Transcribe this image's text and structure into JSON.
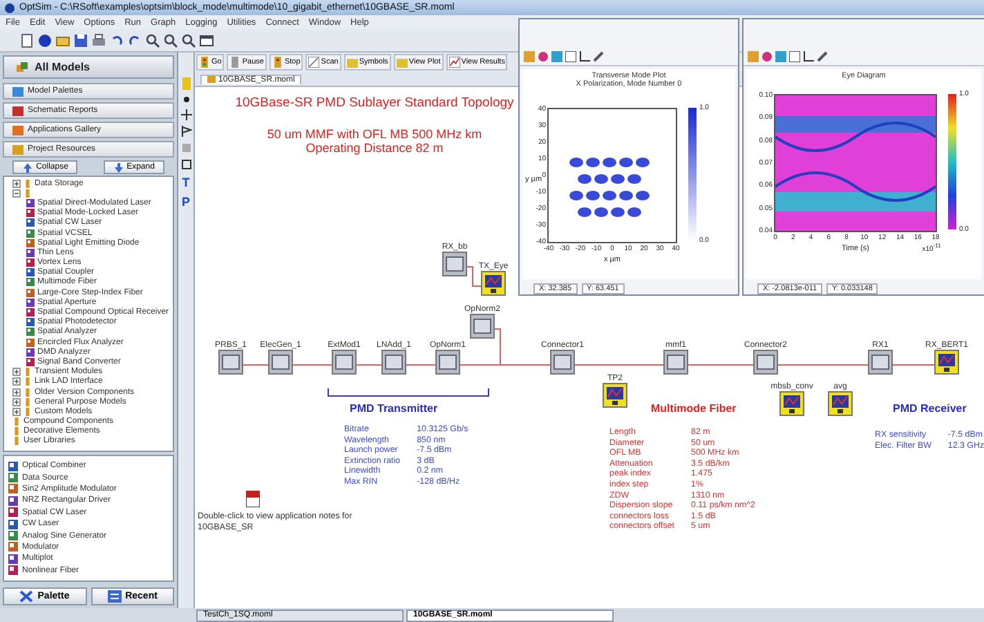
{
  "window": {
    "title": "OptSim - C:\\RSoft\\examples\\optsim\\block_mode\\multimode\\10_gigabit_ethernet\\10GBASE_SR.moml"
  },
  "menu": [
    "File",
    "Edit",
    "View",
    "Options",
    "Run",
    "Graph",
    "Logging",
    "Utilities",
    "Connect",
    "Window",
    "Help"
  ],
  "models_panel": {
    "title": "All Models",
    "sections": [
      "Model Palettes",
      "Schematic Reports",
      "Applications Gallery",
      "Project Resources"
    ],
    "buttons": [
      "Collapse",
      "Expand"
    ],
    "tree": [
      {
        "label": "Data Storage",
        "expanded": false
      },
      {
        "expanded": true,
        "children": [
          {
            "label": "Spatial Direct-Modulated Laser"
          },
          {
            "label": "Spatial Mode-Locked Laser"
          },
          {
            "label": "Spatial CW Laser"
          },
          {
            "label": "Spatial VCSEL"
          },
          {
            "label": "Spatial Light Emitting Diode"
          },
          {
            "label": "Thin Lens"
          },
          {
            "label": "Vortex Lens"
          },
          {
            "label": "Spatial Coupler"
          },
          {
            "label": "Multimode Fiber"
          },
          {
            "label": "Large-Core Step-Index Fiber"
          },
          {
            "label": "Spatial Aperture"
          },
          {
            "label": "Spatial Compound Optical Receiver"
          },
          {
            "label": "Spatial Photodetector"
          },
          {
            "label": "Spatial Analyzer"
          },
          {
            "label": "Encircled Flux Analyzer"
          },
          {
            "label": "DMD Analyzer"
          },
          {
            "label": "Signal Band Converter"
          }
        ]
      },
      {
        "label": "Transient Modules",
        "expanded": false
      },
      {
        "label": "Link LAD Interface",
        "expanded": false
      },
      {
        "label": "Older Version Components",
        "expanded": false
      },
      {
        "label": "General Purpose Models",
        "expanded": false
      },
      {
        "label": "Custom Models",
        "expanded": false
      },
      {
        "label": "Compound Components"
      },
      {
        "label": "Decorative Elements"
      },
      {
        "label": "User Libraries"
      }
    ],
    "recent": [
      "Optical Combiner",
      "Data Source",
      "Sin2 Amplitude Modulator",
      "NRZ Rectangular Driver",
      "Spatial CW Laser",
      "CW Laser",
      "Analog Sine Generator",
      "Modulator",
      "Multiplot",
      "Nonlinear Fiber"
    ],
    "bottom_buttons": [
      "Palette",
      "Recent"
    ]
  },
  "drawing_tools": [
    "T",
    "P"
  ],
  "run_toolbar": [
    "Go",
    "Pause",
    "Stop",
    "Scan",
    "Symbols",
    "View Plot",
    "View Results"
  ],
  "document_tab": "10GBASE_SR.moml",
  "schematic": {
    "title_lines": [
      "10GBase-SR  PMD Sublayer Standard Topology",
      "50 um MMF with OFL MB 500 MHz km",
      "Operating Distance 82 m"
    ],
    "nodes": [
      {
        "label": "PRBS_1",
        "kind": "block"
      },
      {
        "label": "ElecGen_1",
        "kind": "block"
      },
      {
        "label": "ExtMod1",
        "kind": "block"
      },
      {
        "label": "LNAdd_1",
        "kind": "block"
      },
      {
        "label": "OpNorm1",
        "kind": "block"
      },
      {
        "label": "Connector1",
        "kind": "block"
      },
      {
        "label": "mmf1",
        "kind": "block"
      },
      {
        "label": "Connector2",
        "kind": "block"
      },
      {
        "label": "RX1",
        "kind": "block"
      },
      {
        "label": "RX_BERT1",
        "kind": "scope"
      },
      {
        "label": "RX_bb",
        "kind": "block"
      },
      {
        "label": "TX_Eye",
        "kind": "scope"
      },
      {
        "label": "OpNorm2",
        "kind": "block"
      },
      {
        "label": "TP2",
        "kind": "scope"
      },
      {
        "label": "mbsb_conv",
        "kind": "scope"
      },
      {
        "label": "avg",
        "kind": "scope"
      }
    ],
    "groups": [
      {
        "label": "PMD Transmitter",
        "kind": "transmitter",
        "params": [
          [
            "Bitrate",
            "10.3125 Gb/s"
          ],
          [
            "Wavelength",
            "850 nm"
          ],
          [
            "Launch power",
            "-7.5 dBm"
          ],
          [
            "Extinction ratio",
            "3 dB"
          ],
          [
            "Linewidth",
            "0.2 nm"
          ],
          [
            "Max RIN",
            "-128 dB/Hz"
          ]
        ]
      },
      {
        "label": "Multimode Fiber",
        "kind": "fiber",
        "params": [
          [
            "Length",
            "82 m"
          ],
          [
            "Diameter",
            "50 um"
          ],
          [
            "OFL MB",
            "500 MHz km"
          ],
          [
            "Attenuation",
            "3.5 dB/km"
          ],
          [
            "peak index",
            "1.475"
          ],
          [
            "index step",
            "1%"
          ],
          [
            "ZDW",
            "1310 nm"
          ],
          [
            "Dispersion slope",
            "0.11 ps/km nm^2"
          ],
          [
            "connectors loss",
            "1.5 dB"
          ],
          [
            "connectors offset",
            "5 um"
          ]
        ]
      },
      {
        "label": "PMD Receiver",
        "kind": "receiver",
        "params": [
          [
            "RX sensitivity",
            "-7.5 dBm"
          ],
          [
            "Elec. Filter BW",
            "12.3 GHz"
          ]
        ]
      }
    ],
    "note": "Double-click to view application notes for 10GBASE_SR"
  },
  "plots": [
    {
      "kind": "mode",
      "title_lines": [
        "Transverse Mode Plot",
        "X Polarization, Mode Number 0"
      ],
      "yticks": [
        "40",
        "30",
        "20",
        "10",
        "0",
        "-10",
        "-20",
        "-30",
        "-40"
      ],
      "xticks": [
        "-40",
        "-30",
        "-20",
        "-10",
        "0",
        "10",
        "20",
        "30",
        "40"
      ],
      "xlabel": "x µm",
      "ylabel": "y µm",
      "colorbar": [
        "1.0",
        "0.0"
      ],
      "readout": [
        "X: 32.385",
        "Y: 63.451"
      ]
    },
    {
      "kind": "eye",
      "title_lines": [
        "Eye Diagram"
      ],
      "yticks": [
        "0.10",
        "0.09",
        "0.08",
        "0.07",
        "0.06",
        "0.05",
        "0.04"
      ],
      "xticks": [
        "0",
        "2",
        "4",
        "6",
        "8",
        "10",
        "12",
        "14",
        "16",
        "18"
      ],
      "xlabel": "Time (s)",
      "xscale": "x10$^{-11}$",
      "colorbar": [
        "1.0",
        "0.0"
      ],
      "readout": [
        "X: -2.0813e-011",
        "Y: 0.033148"
      ]
    }
  ],
  "bottom_tabs": [
    {
      "label": "TestCh_1SQ.moml",
      "selected": false
    },
    {
      "label": "10GBASE_SR.moml",
      "selected": true
    }
  ]
}
